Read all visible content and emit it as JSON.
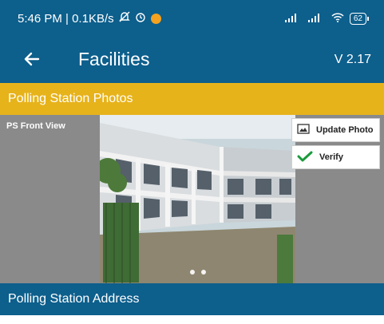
{
  "status_bar": {
    "text": "5:46 PM | 0.1KB/s",
    "battery": "62"
  },
  "app_bar": {
    "title": "Facilities",
    "version": "V 2.17"
  },
  "sections": {
    "photos_title": "Polling Station Photos",
    "address_title": "Polling Station Address"
  },
  "photo": {
    "label": "PS Front View",
    "update_button": "Update Photo",
    "verify_button": "Verify",
    "carousel_pages": 2
  },
  "colors": {
    "primary": "#0d5f8c",
    "yellow": "#e7b31b",
    "verify_green": "#1a9b3a"
  }
}
